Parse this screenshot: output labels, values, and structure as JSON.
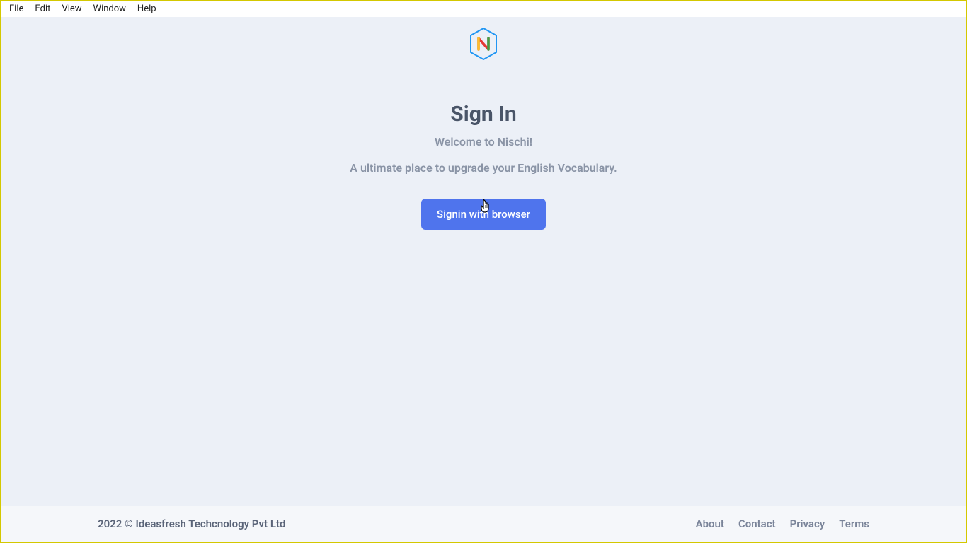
{
  "menubar": {
    "items": [
      {
        "label": "File"
      },
      {
        "label": "Edit"
      },
      {
        "label": "View"
      },
      {
        "label": "Window"
      },
      {
        "label": "Help"
      }
    ]
  },
  "main": {
    "title": "Sign In",
    "welcome": "Welcome to Nischi!",
    "description": "A ultimate place to upgrade your English Vocabulary.",
    "signin_button": "Signin with browser"
  },
  "footer": {
    "copyright": "2022 © Ideasfresh Techcnology Pvt Ltd",
    "links": [
      {
        "label": "About"
      },
      {
        "label": "Contact"
      },
      {
        "label": "Privacy"
      },
      {
        "label": "Terms"
      }
    ]
  }
}
